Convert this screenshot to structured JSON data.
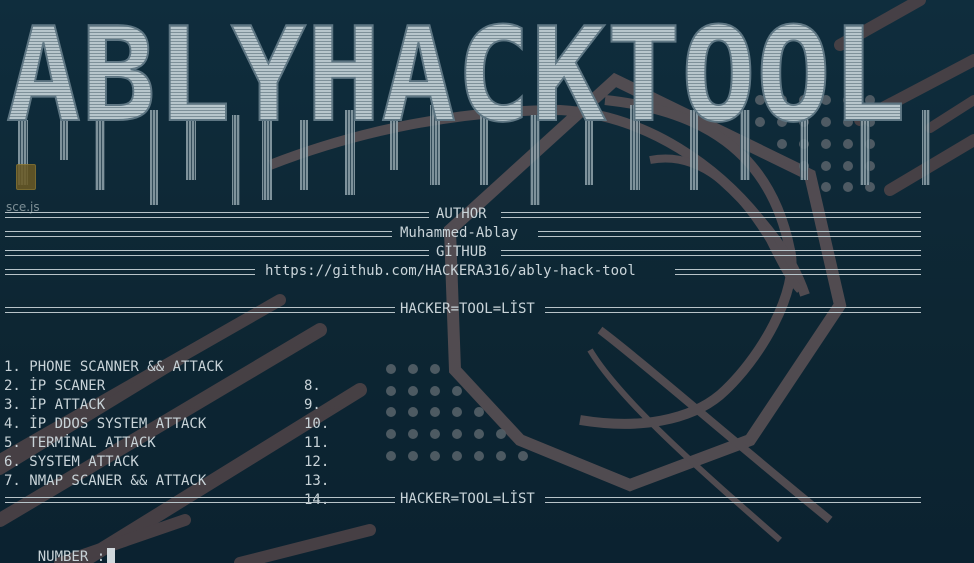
{
  "banner": {
    "text": "ABLYHACKTOOL"
  },
  "desktop": {
    "icon_label": "sce.js"
  },
  "header": {
    "author_title": "AUTHOR",
    "author_name": "Muhammed-Ablay",
    "github_title": "GİTHUB",
    "github_url": "https://github.com/HACKERA316/ably-hack-tool",
    "list_title": "HACKER=TOOL=LİST"
  },
  "menu": {
    "left": [
      "1. PHONE SCANNER && ATTACK",
      "2. İP SCANER",
      "3. İP ATTACK",
      "4. İP DDOS SYSTEM ATTACK",
      "5. TERMİNAL ATTACK",
      "6. SYSTEM ATTACK",
      "7. NMAP SCANER && ATTACK"
    ],
    "right": [
      "8.",
      "9.",
      "10.",
      "11.",
      "12.",
      "13.",
      "14."
    ]
  },
  "prompt": {
    "label": "NUMBER :"
  },
  "colors": {
    "background": "#0f2d3d",
    "text": "#c8d3d8",
    "banner": "#c9d7dc",
    "accent": "#6e5f63"
  }
}
